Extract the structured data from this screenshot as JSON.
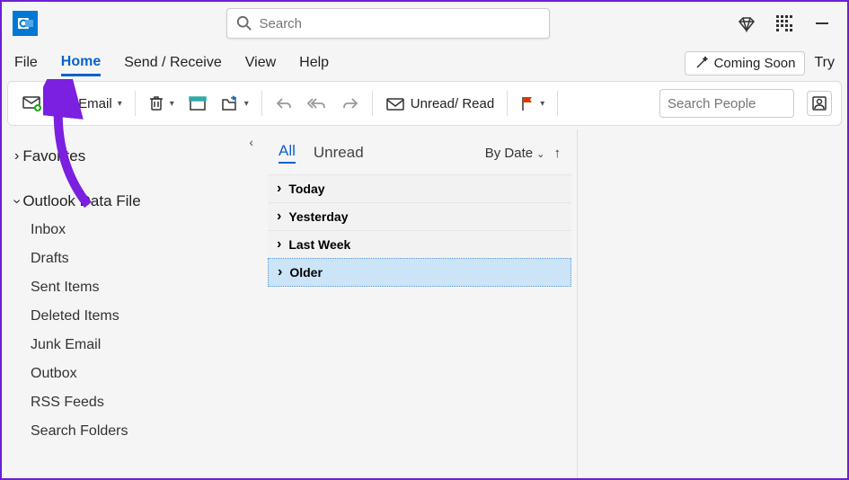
{
  "titlebar": {
    "search_placeholder": "Search"
  },
  "tabs": {
    "items": [
      "File",
      "Home",
      "Send / Receive",
      "View",
      "Help"
    ],
    "active_index": 1,
    "coming_soon": "Coming Soon",
    "try": "Try"
  },
  "toolbar": {
    "new_email": "New Email",
    "unread_read": "Unread/ Read",
    "search_people_placeholder": "Search People"
  },
  "sidebar": {
    "favorites": "Favorites",
    "data_file": "Outlook Data File",
    "folders": [
      "Inbox",
      "Drafts",
      "Sent Items",
      "Deleted Items",
      "Junk Email",
      "Outbox",
      "RSS Feeds",
      "Search Folders"
    ]
  },
  "msglist": {
    "filters": {
      "all": "All",
      "unread": "Unread"
    },
    "sort": "By Date",
    "groups": [
      "Today",
      "Yesterday",
      "Last Week",
      "Older"
    ],
    "selected_index": 3
  }
}
